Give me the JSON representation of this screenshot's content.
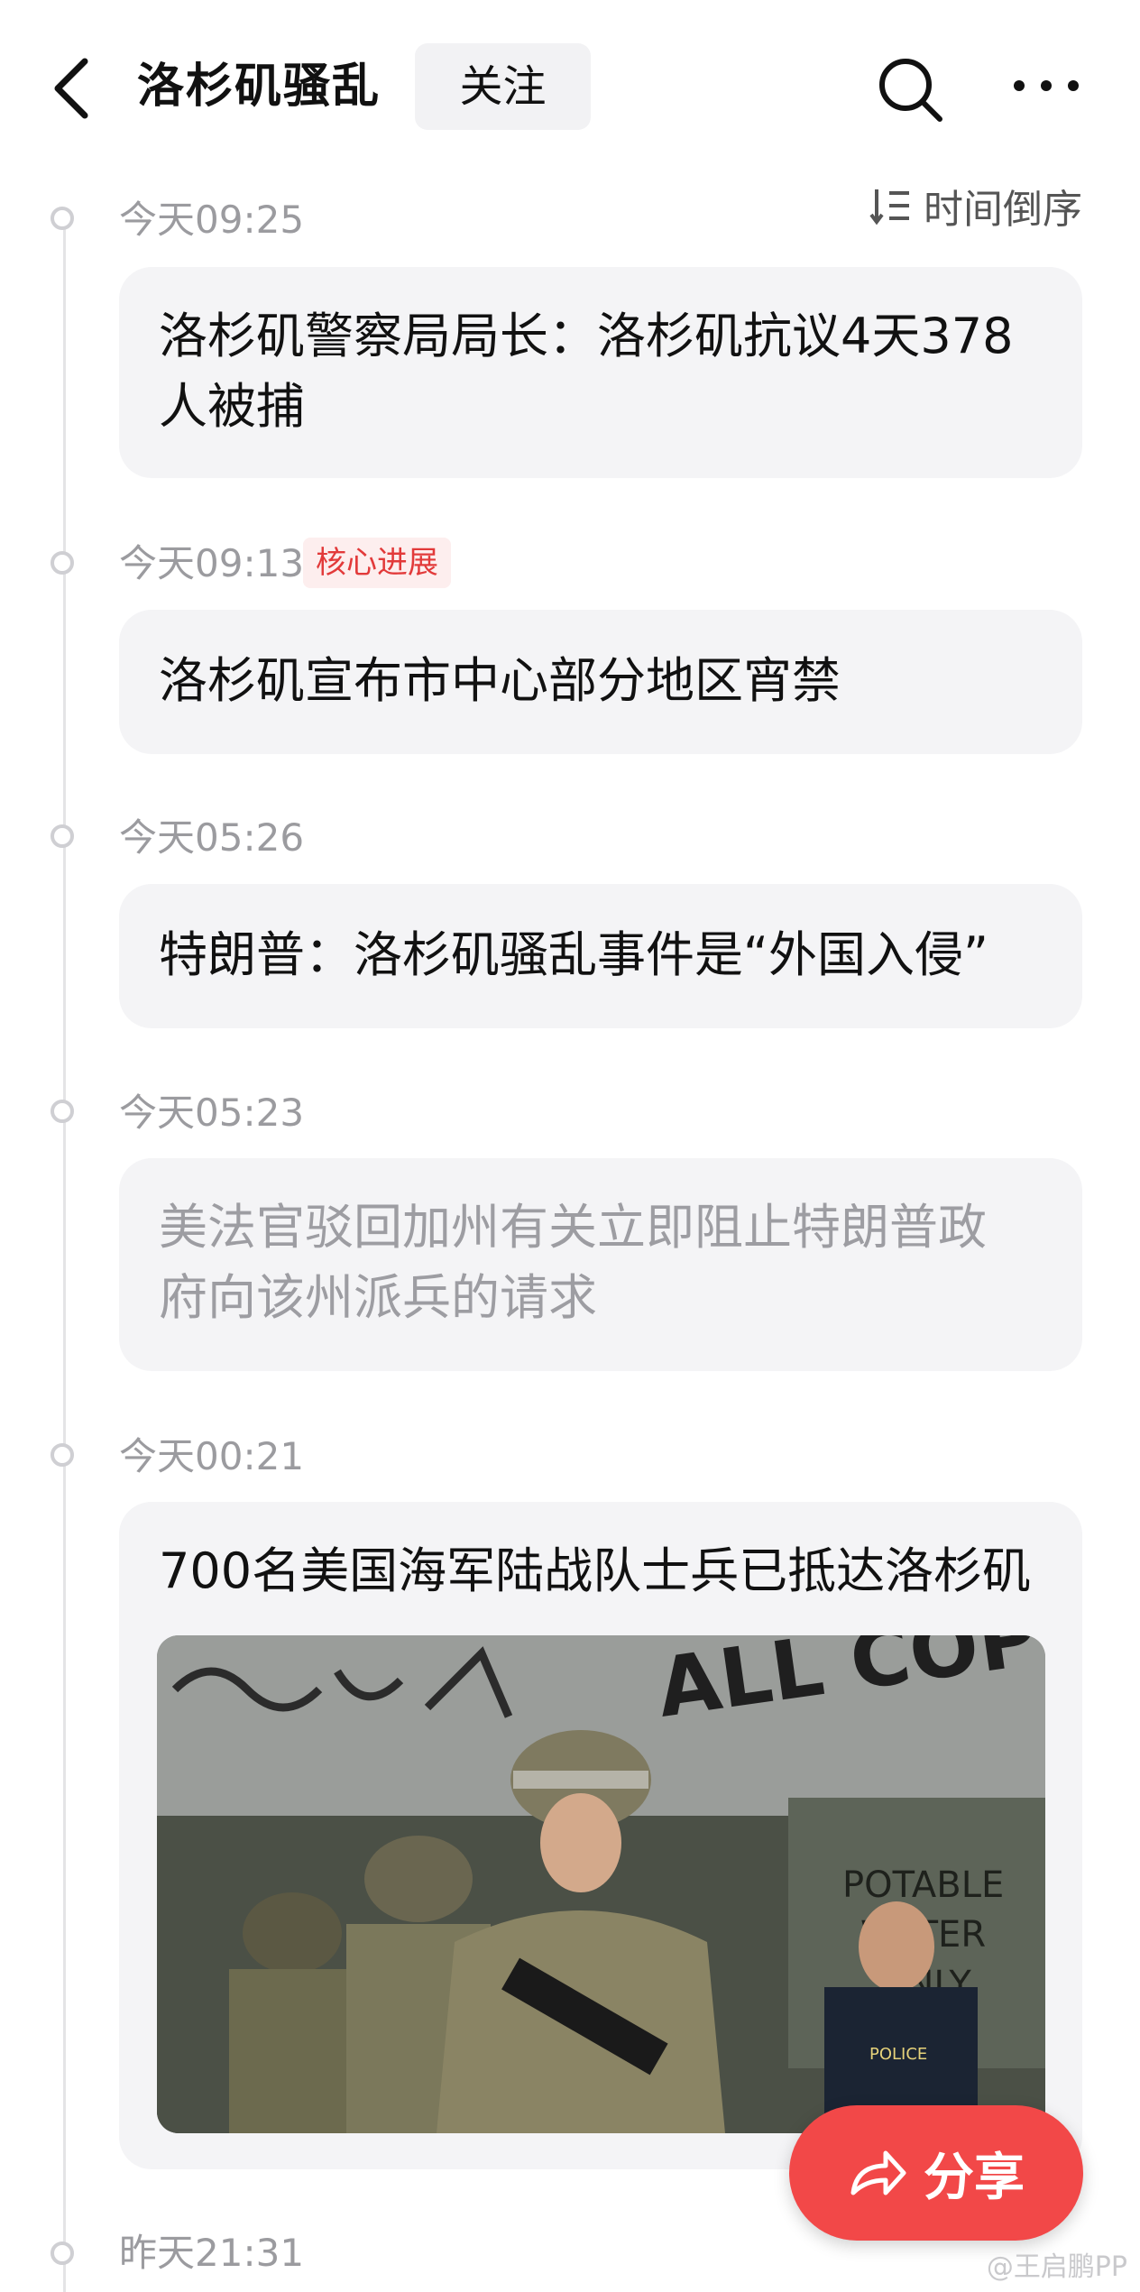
{
  "header": {
    "title": "洛杉矶骚乱",
    "follow_label": "关注"
  },
  "sort": {
    "label": "时间倒序"
  },
  "timeline": [
    {
      "time": "今天09:25",
      "text_lines": [
        "洛杉矶警察局局长：洛杉矶抗议4天378",
        "人被捕"
      ]
    },
    {
      "time": "今天09:13",
      "badge": "核心进展",
      "text_lines": [
        "洛杉矶宣布市中心部分地区宵禁"
      ]
    },
    {
      "time": "今天05:26",
      "text_lines": [
        "特朗普：洛杉矶骚乱事件是“外国入侵”"
      ]
    },
    {
      "time": "今天05:23",
      "text_lines": [
        "美法官驳回加州有关立即阻止特朗普政",
        "府向该州派兵的请求"
      ]
    },
    {
      "time": "今天00:21",
      "text_lines": [
        "700名美国海军陆战队士兵已抵达洛杉矶"
      ],
      "image_text": [
        "ALL COPS",
        "POTABLE",
        "WATER",
        "ONLY",
        "POLICE"
      ]
    },
    {
      "time": "昨天21:31"
    }
  ],
  "share": {
    "label": "分享"
  },
  "watermark": "@王启鹏PP",
  "colors": {
    "accent": "#f24848",
    "badge": "#e23a3a",
    "card_bg": "#f4f4f6"
  },
  "icons": [
    "back-arrow-icon",
    "search-icon",
    "more-icon",
    "sort-icon",
    "share-icon"
  ]
}
